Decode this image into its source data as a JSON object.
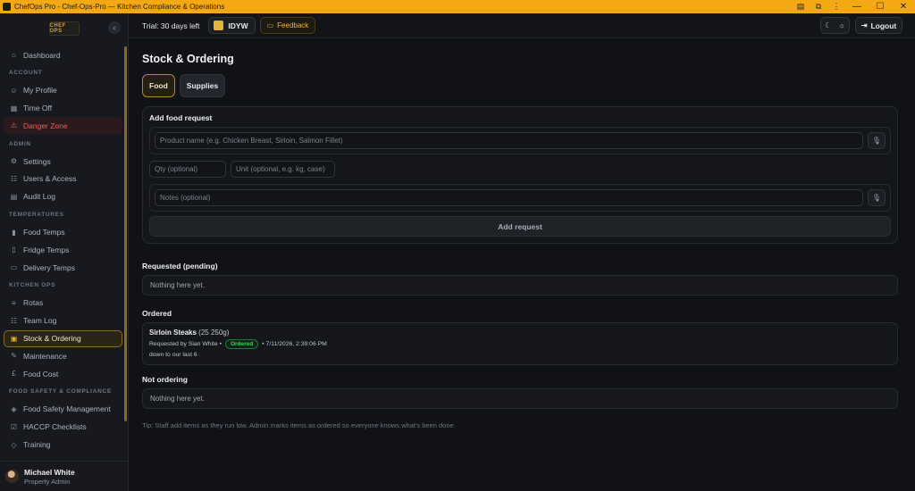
{
  "window": {
    "title": "ChefOps Pro - Chef-Ops-Pro — Kitchen Compliance & Operations",
    "controls": {
      "minimize": "—",
      "maximize": "☐",
      "close": "✕"
    }
  },
  "sidebar": {
    "logo_text": "CHEF OPS",
    "collapse_glyph": "‹",
    "items": [
      {
        "label": "Dashboard",
        "icon": "home-icon"
      },
      {
        "section": "ACCOUNT"
      },
      {
        "label": "My Profile",
        "icon": "user-icon"
      },
      {
        "label": "Time Off",
        "icon": "calendar-icon"
      },
      {
        "label": "Danger Zone",
        "icon": "warning-icon"
      },
      {
        "section": "ADMIN"
      },
      {
        "label": "Settings",
        "icon": "gear-icon"
      },
      {
        "label": "Users & Access",
        "icon": "users-icon"
      },
      {
        "label": "Audit Log",
        "icon": "log-icon"
      },
      {
        "section": "TEMPERATURES"
      },
      {
        "label": "Food Temps",
        "icon": "thermometer-icon"
      },
      {
        "label": "Fridge Temps",
        "icon": "fridge-icon"
      },
      {
        "label": "Delivery Temps",
        "icon": "truck-icon"
      },
      {
        "section": "KITCHEN OPS"
      },
      {
        "label": "Rotas",
        "icon": "list-icon"
      },
      {
        "label": "Team Log",
        "icon": "team-icon"
      },
      {
        "label": "Stock & Ordering",
        "icon": "box-icon"
      },
      {
        "label": "Maintenance",
        "icon": "wrench-icon"
      },
      {
        "label": "Food Cost",
        "icon": "pound-icon"
      },
      {
        "section": "FOOD SAFETY & COMPLIANCE"
      },
      {
        "label": "Food Safety Management",
        "icon": "shield-icon"
      },
      {
        "label": "HACCP Checklists",
        "icon": "checklist-icon"
      },
      {
        "label": "Training",
        "icon": "graduation-icon"
      }
    ],
    "user": {
      "name": "Michael White",
      "role": "Property Admin"
    }
  },
  "topbar": {
    "trial": "Trial: 30 days left",
    "org": "IDYW",
    "feedback": "Feedback",
    "logout": "Logout"
  },
  "main": {
    "title": "Stock & Ordering",
    "tabs": [
      {
        "label": "Food"
      },
      {
        "label": "Supplies"
      }
    ],
    "form": {
      "title": "Add food request",
      "product_placeholder": "Product name (e.g. Chicken Breast, Sirloin, Salmon Fillet)",
      "qty_placeholder": "Qty (optional)",
      "unit_placeholder": "Unit (optional, e.g. kg, case)",
      "notes_placeholder": "Notes (optional)",
      "submit": "Add request"
    },
    "requested": {
      "title": "Requested (pending)",
      "empty": "Nothing here yet."
    },
    "ordered": {
      "title": "Ordered",
      "item": {
        "name": "Sirloin Steaks",
        "qty": "(25 250g)",
        "requested_by": "Requested by Sian White •",
        "status": "Ordered",
        "date": "• 7/11/2026, 2:39:06 PM",
        "note": "down to our last 6"
      }
    },
    "not_ordering": {
      "title": "Not ordering",
      "empty": "Nothing here yet."
    },
    "tip": "Tip: Staff add items as they run low. Admin marks items as ordered so everyone knows what's been done."
  },
  "colors": {
    "accent": "#f3a814",
    "danger": "#f05a5a",
    "success": "#3ccf6a"
  }
}
